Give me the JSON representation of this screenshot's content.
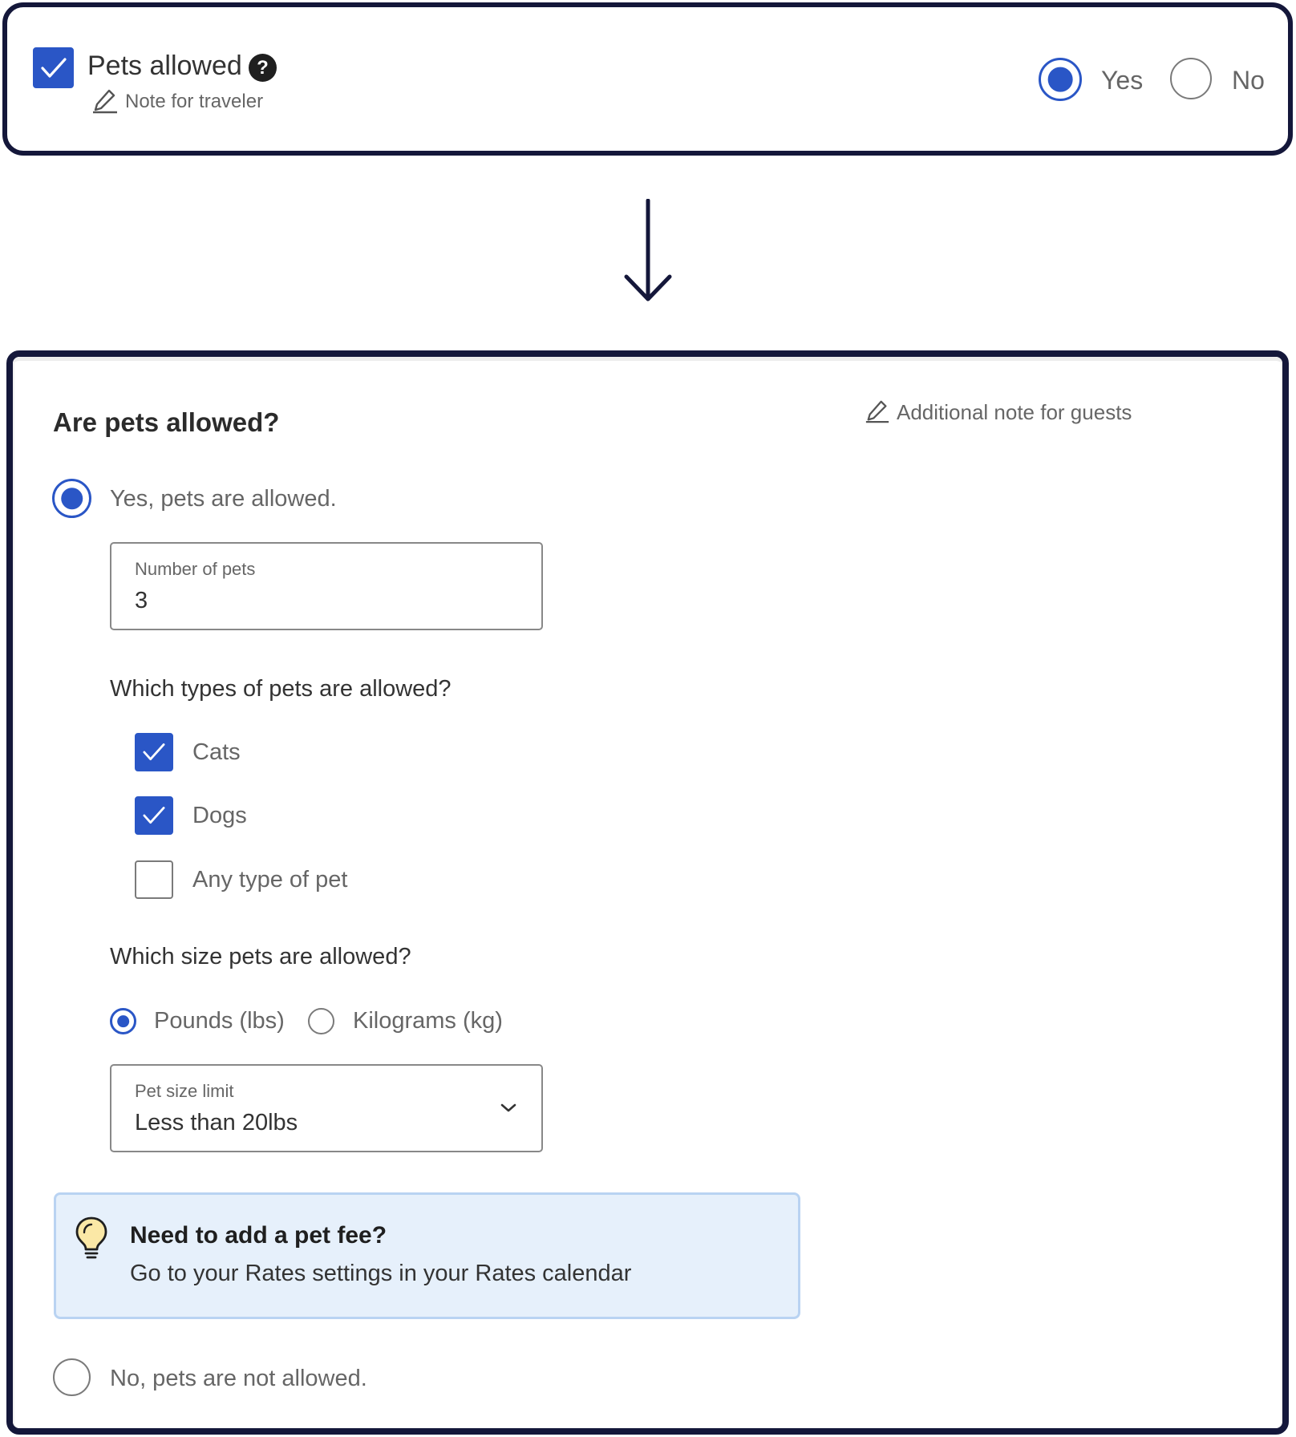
{
  "top_card": {
    "checkbox_checked": true,
    "title": "Pets allowed",
    "help_icon": "question-circle-icon",
    "note_link": "Note for traveler",
    "yes_label": "Yes",
    "no_label": "No",
    "selected": "Yes"
  },
  "arrow_icon": "arrow-down-icon",
  "bottom_card": {
    "question": "Are pets allowed?",
    "note_link": "Additional note for guests",
    "yes_option": "Yes, pets are allowed.",
    "number_field": {
      "label": "Number of pets",
      "value": "3"
    },
    "types_question": "Which types of pets are allowed?",
    "types": [
      {
        "label": "Cats",
        "checked": true
      },
      {
        "label": "Dogs",
        "checked": true
      },
      {
        "label": "Any type of pet",
        "checked": false
      }
    ],
    "size_question": "Which size pets are allowed?",
    "units": [
      {
        "label": "Pounds (lbs)",
        "selected": true
      },
      {
        "label": "Kilograms (kg)",
        "selected": false
      }
    ],
    "size_select": {
      "label": "Pet size limit",
      "value": "Less than 20lbs"
    },
    "tip": {
      "icon": "lightbulb-icon",
      "title": "Need to add a pet fee?",
      "body": "Go to your Rates settings in your Rates calendar"
    },
    "no_option": "No, pets are not allowed."
  },
  "colors": {
    "accent": "#2a56c6",
    "frame": "#14173a",
    "tip_bg": "#e6f0fb"
  }
}
